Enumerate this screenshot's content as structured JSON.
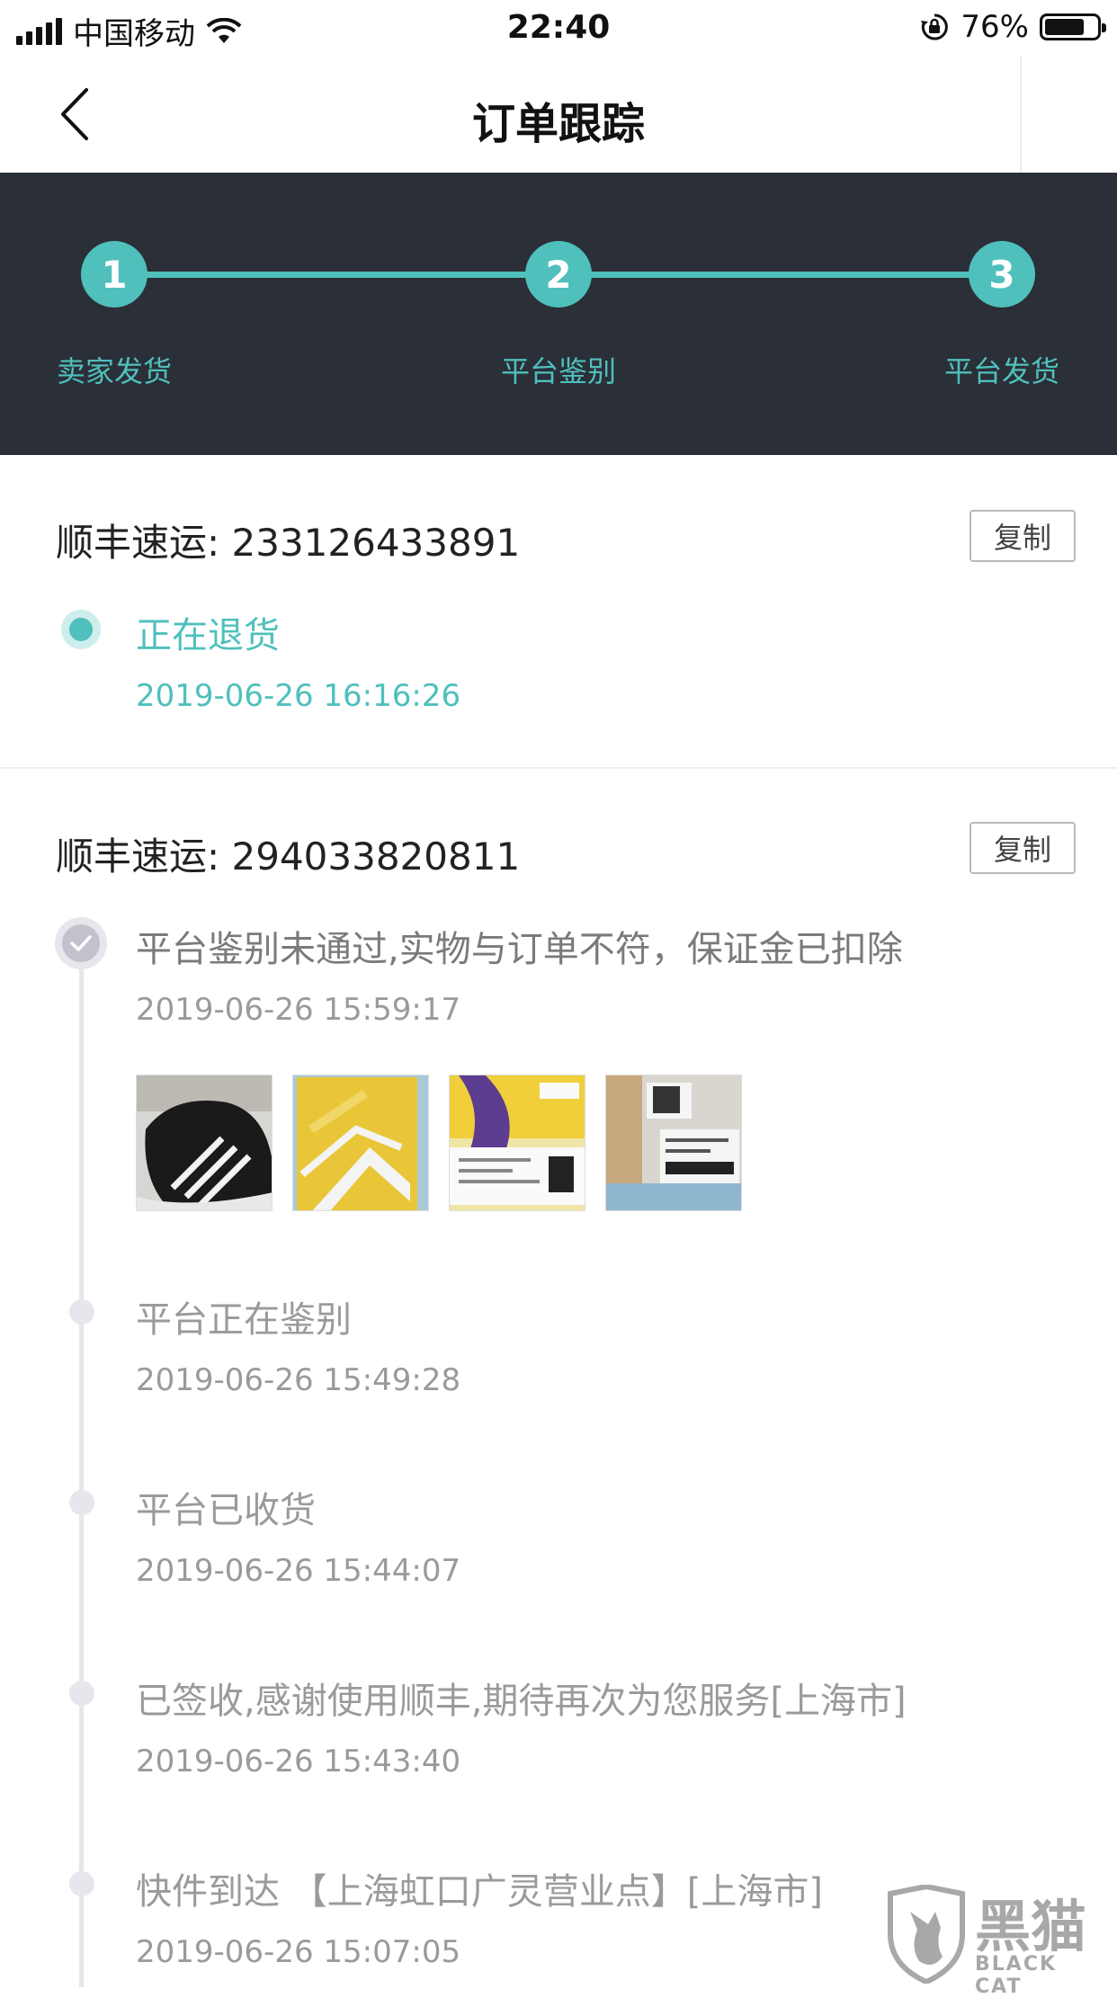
{
  "status_bar": {
    "carrier": "中国移动",
    "time": "22:40",
    "battery_percent": "76%",
    "battery_level": 0.76
  },
  "nav": {
    "title": "订单跟踪"
  },
  "progress": {
    "steps": [
      {
        "number": "1",
        "label": "卖家发货"
      },
      {
        "number": "2",
        "label": "平台鉴别"
      },
      {
        "number": "3",
        "label": "平台发货"
      }
    ]
  },
  "shipments": [
    {
      "carrier_label": "顺丰速运: 233126433891",
      "copy_label": "复制",
      "events": [
        {
          "title": "正在退货",
          "time": "2019-06-26 16:16:26"
        }
      ]
    },
    {
      "carrier_label": "顺丰速运: 294033820811",
      "copy_label": "复制",
      "events": [
        {
          "title": "平台鉴别未通过,实物与订单不符，保证金已扣除",
          "time": "2019-06-26 15:59:17"
        },
        {
          "title": "平台正在鉴别",
          "time": "2019-06-26 15:49:28"
        },
        {
          "title": "平台已收货",
          "time": "2019-06-26 15:44:07"
        },
        {
          "title": "已签收,感谢使用顺丰,期待再次为您服务[上海市]",
          "time": "2019-06-26 15:43:40"
        },
        {
          "title": "快件到达 【上海虹口广灵营业点】[上海市]",
          "time": "2019-06-26 15:07:05"
        }
      ]
    }
  ],
  "watermark": {
    "title": "黑猫",
    "subtitle": "BLACK CAT"
  },
  "colors": {
    "accent": "#4fc0bc",
    "progress_bg": "#2b2f38",
    "muted": "#9a9a9a"
  }
}
